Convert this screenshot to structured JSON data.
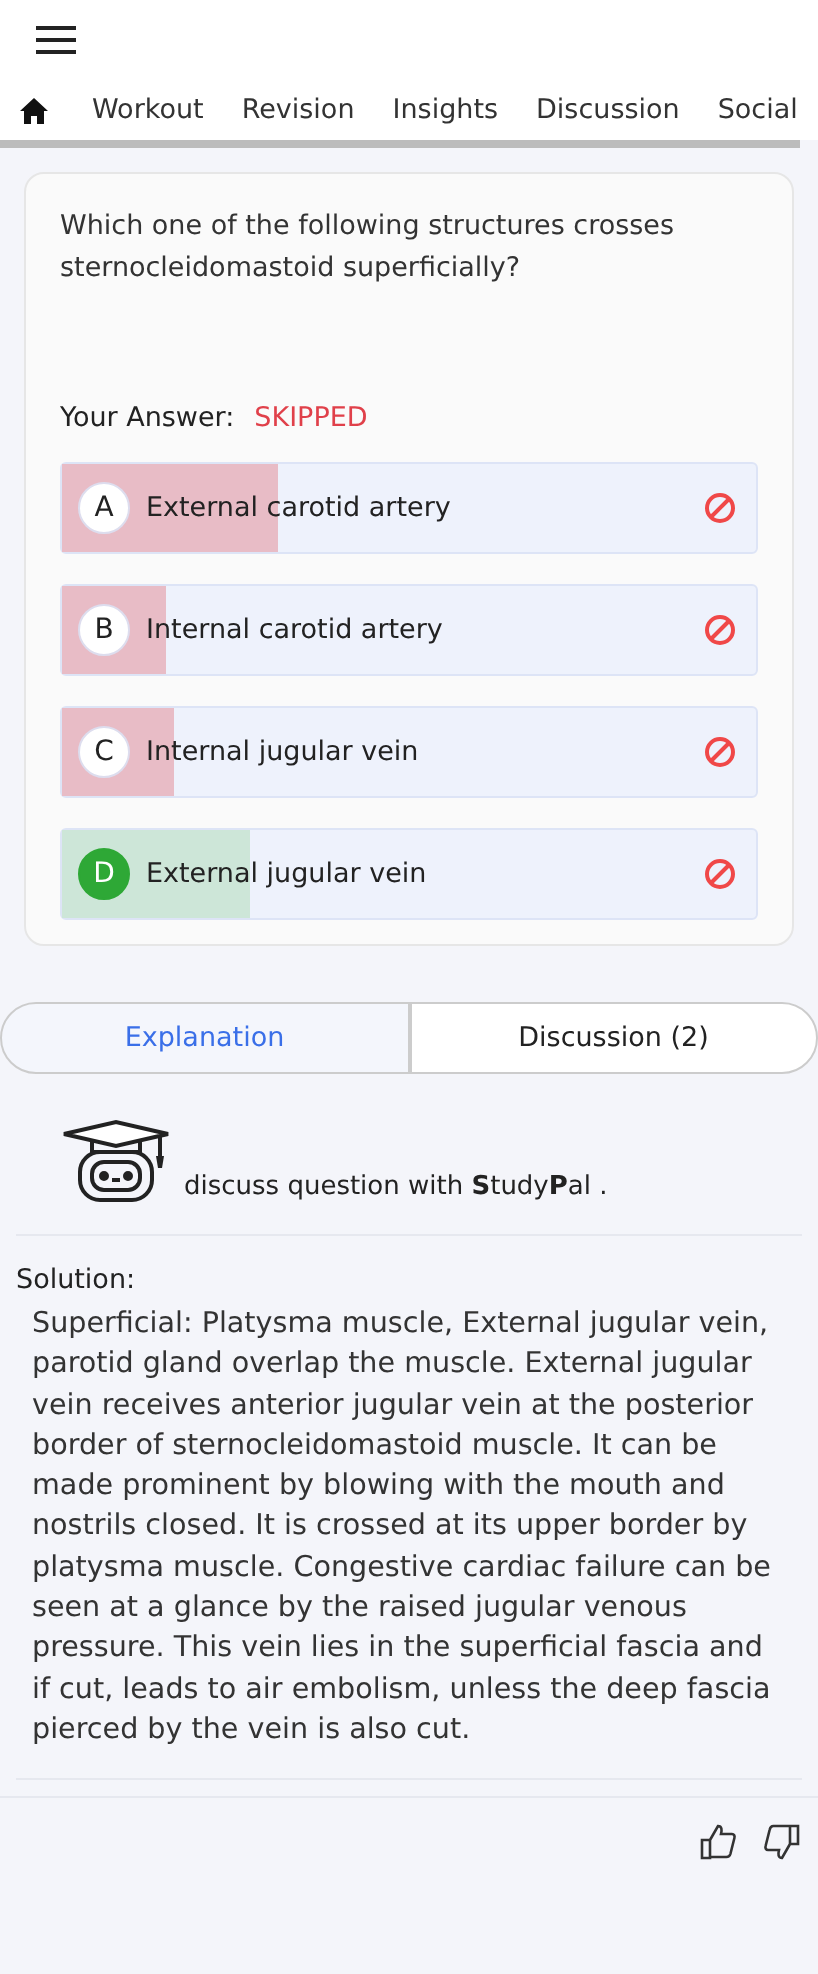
{
  "nav": {
    "tabs": [
      {
        "label": "Workout"
      },
      {
        "label": "Revision"
      },
      {
        "label": "Insights"
      },
      {
        "label": "Discussion"
      },
      {
        "label": "Social"
      }
    ]
  },
  "question": {
    "text": "Which one of the following structures crosses sternocleidomastoid superficially?",
    "answer_label": "Your Answer:",
    "answer_value": "SKIPPED",
    "options": [
      {
        "letter": "A",
        "text": "External carotid artery",
        "correct": false,
        "level": 0.31
      },
      {
        "letter": "B",
        "text": "Internal carotid artery",
        "correct": false,
        "level": 0.15
      },
      {
        "letter": "C",
        "text": "Internal jugular vein",
        "correct": false,
        "level": 0.16
      },
      {
        "letter": "D",
        "text": "External jugular vein",
        "correct": true,
        "level": 0.27
      }
    ]
  },
  "tabs": [
    {
      "label": "Explanation",
      "selected": true
    },
    {
      "label": "Discussion (2)",
      "selected": false
    }
  ],
  "studypal": {
    "text": "discuss question with **S**tudy**P**al ."
  },
  "solution": {
    "title": "Solution:",
    "text": "Superficial: Platysma muscle, External jugular vein, parotid gland overlap the muscle. External jugular vein receives anterior jugular vein at the posterior border of sternocleidomastoid muscle. It can be made prominent by blowing with the mouth and nostrils closed. It is crossed at its upper border by platysma muscle. Congestive cardiac failure can be seen at a glance by the raised jugular venous pressure. This vein lies in the superficial fascia and if cut, leads to air embolism, unless the deep fascia pierced by the vein is also cut."
  }
}
